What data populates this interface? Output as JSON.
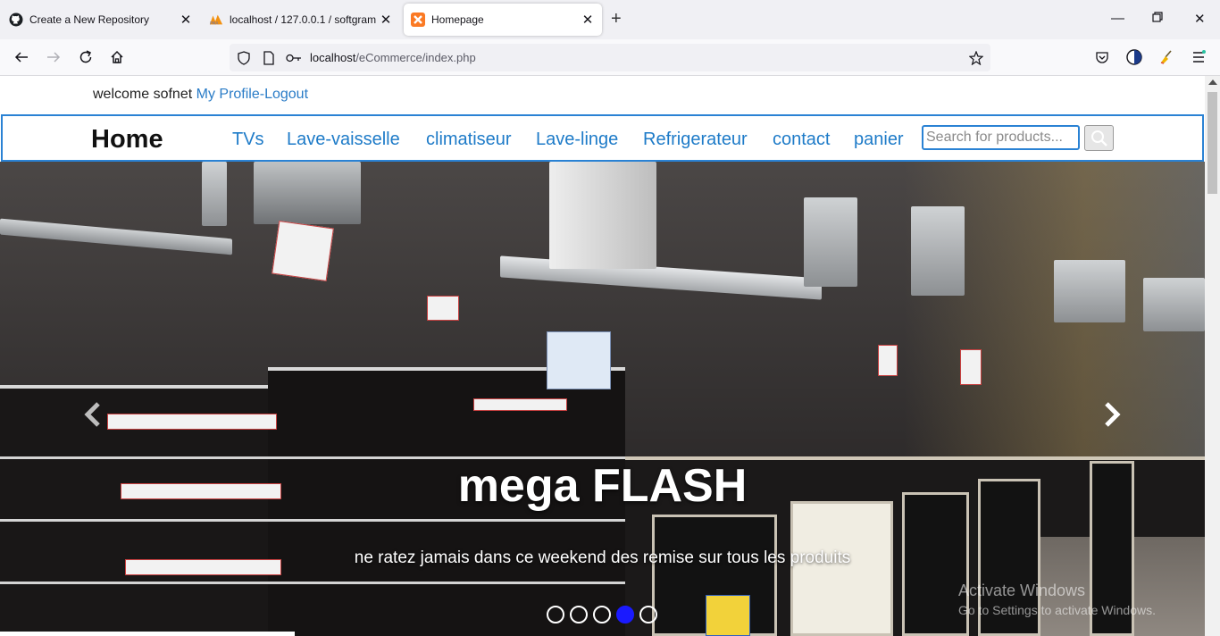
{
  "browser": {
    "tabs": [
      {
        "title": "Create a New Repository",
        "icon": "github-icon",
        "active": false
      },
      {
        "title": "localhost / 127.0.0.1 / softgram",
        "icon": "phpmyadmin-icon",
        "active": false
      },
      {
        "title": "Homepage",
        "icon": "xampp-icon",
        "active": true
      }
    ],
    "url_host": "localhost",
    "url_path": "/eCommerce/index.php"
  },
  "header": {
    "welcome_text": "welcome sofnet",
    "profile_link": "My Profile",
    "separator": "-",
    "logout_link": "Logout"
  },
  "nav": {
    "brand": "Home",
    "links": [
      "TVs",
      "Lave-vaisselle",
      "climatiseur",
      "Lave-linge",
      "Refrigerateur",
      "contact",
      "panier"
    ],
    "search_placeholder": "Search for products..."
  },
  "carousel": {
    "title": "mega FLASH",
    "subtitle": "ne ratez jamais dans ce weekend des remise sur tous les produits",
    "slide_count": 5,
    "active_index": 3
  },
  "watermark": {
    "line1": "Activate Windows",
    "line2": "Go to Settings to activate Windows."
  },
  "colors": {
    "link": "#1e7bc8",
    "nav_border": "#2a82d4",
    "active_indicator": "#1a1aff"
  }
}
